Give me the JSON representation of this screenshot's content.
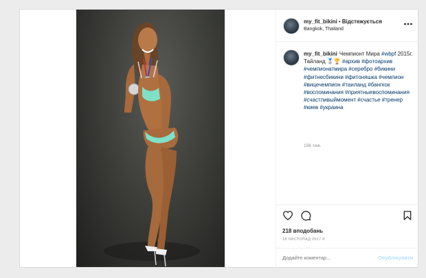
{
  "post": {
    "username": "my_fit_bikini",
    "follow_label": "Відстежується",
    "location": "Bangkok, Thailand",
    "caption": {
      "username": "my_fit_bikini",
      "segments": [
        {
          "type": "text",
          "value": "Чемпионт Мира "
        },
        {
          "type": "tag",
          "value": "#wbpf"
        },
        {
          "type": "text",
          "value": " 2015г. Тайланд 🥈🏆 "
        },
        {
          "type": "tag",
          "value": "#архив"
        },
        {
          "type": "text",
          "value": " "
        },
        {
          "type": "tag",
          "value": "#фотоархив"
        },
        {
          "type": "text",
          "value": " "
        },
        {
          "type": "tag",
          "value": "#чемпионатмира"
        },
        {
          "type": "text",
          "value": " "
        },
        {
          "type": "tag",
          "value": "#серебро"
        },
        {
          "type": "text",
          "value": " "
        },
        {
          "type": "tag",
          "value": "#бикини"
        },
        {
          "type": "text",
          "value": " "
        },
        {
          "type": "tag",
          "value": "#фитнесбикини"
        },
        {
          "type": "text",
          "value": " "
        },
        {
          "type": "tag",
          "value": "#фитоняшка"
        },
        {
          "type": "text",
          "value": " "
        },
        {
          "type": "tag",
          "value": "#чемпион"
        },
        {
          "type": "text",
          "value": " "
        },
        {
          "type": "tag",
          "value": "#вицечемпион"
        },
        {
          "type": "text",
          "value": " "
        },
        {
          "type": "tag",
          "value": "#таиланд"
        },
        {
          "type": "text",
          "value": " "
        },
        {
          "type": "tag",
          "value": "#бангкок"
        },
        {
          "type": "text",
          "value": " "
        },
        {
          "type": "tag",
          "value": "#воспоминания"
        },
        {
          "type": "text",
          "value": " "
        },
        {
          "type": "tag",
          "value": "#приятныевоспоминания"
        },
        {
          "type": "text",
          "value": " "
        },
        {
          "type": "tag",
          "value": "#счастливыймомент"
        },
        {
          "type": "text",
          "value": " "
        },
        {
          "type": "tag",
          "value": "#счастье"
        },
        {
          "type": "text",
          "value": " "
        },
        {
          "type": "tag",
          "value": "#тренер"
        },
        {
          "type": "text",
          "value": " "
        },
        {
          "type": "tag",
          "value": "#киев"
        },
        {
          "type": "text",
          "value": " "
        },
        {
          "type": "tag",
          "value": "#украина"
        }
      ]
    },
    "time_ago": "156 тиж.",
    "likes": "218 вподобань",
    "date": "18 ЛИСТОПАД 2017 Р.",
    "comment_placeholder": "Додайте коментар...",
    "publish_label": "Опублікувати",
    "icons": {
      "more": "more-horizontal-icon",
      "like": "heart-icon",
      "comment": "comment-bubble-icon",
      "save": "bookmark-icon"
    },
    "colors": {
      "tag": "#00376b",
      "publish_disabled": "#b2dffc",
      "muted": "#8e8e8e",
      "border": "#dbdbdb",
      "page_bg": "#ececec"
    }
  }
}
